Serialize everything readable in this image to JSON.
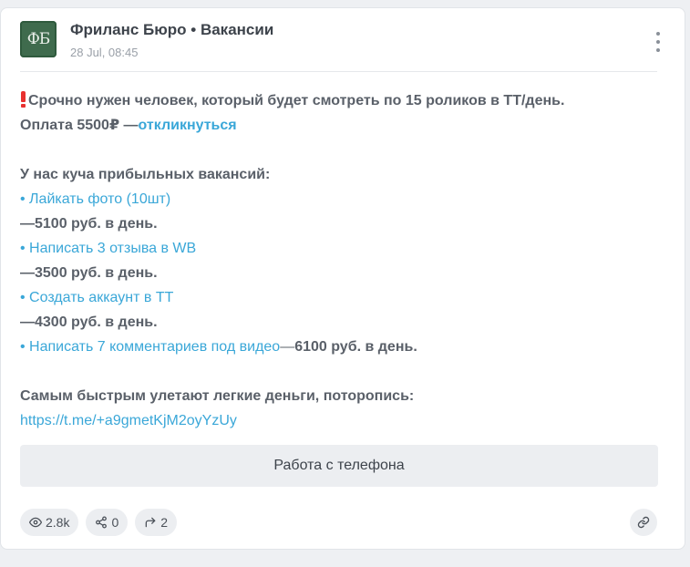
{
  "header": {
    "avatar_text": "ФБ",
    "channel_title": "Фриланс Бюро • Вакансии",
    "date": "28 Jul, 08:45"
  },
  "post": {
    "line1": "Срочно нужен человек, который будет смотреть по 15 роликов в ТТ/день.",
    "line2_prefix": "Оплата 5500₽ —",
    "line2_link": "откликнуться",
    "intro": "У нас куча прибыльных вакансий:",
    "jobs": [
      {
        "bullet": "• ",
        "title": "Лайкать фото (10шт)",
        "pay": "—5100 руб. в день."
      },
      {
        "bullet": "• ",
        "title": "Написать 3 отзыва в WB",
        "pay": "—3500 руб. в день."
      },
      {
        "bullet": "• ",
        "title": "Создать аккаунт в ТТ",
        "pay": "—4300 руб. в день."
      },
      {
        "bullet": "• ",
        "title": "Написать 7 комментариев под видео",
        "dash": "—",
        "pay": "6100 руб. в день."
      }
    ],
    "outro": "Самым быстрым улетают легкие деньги, поторопись:",
    "url": "https://t.me/+a9gmetKjM2oyYzUy"
  },
  "action_button": {
    "label": "Работа с телефона"
  },
  "stats": {
    "views": "2.8k",
    "shares": "0",
    "forwards": "2"
  },
  "icons": {
    "menu": "more-vertical-icon",
    "views": "eye-icon",
    "shares": "share-icon",
    "forwards": "forward-icon",
    "link": "link-icon"
  },
  "colors": {
    "link": "#3aa7d8",
    "alert": "#e8312f",
    "avatar_bg": "#3f6b4d"
  }
}
